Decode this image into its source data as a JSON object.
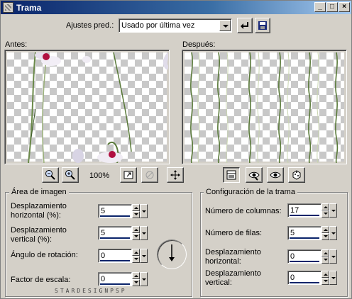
{
  "window": {
    "title": "Trama",
    "minimize_glyph": "_",
    "maximize_glyph": "□",
    "close_glyph": "×"
  },
  "presets": {
    "label": "Ajustes pred.:",
    "selected": "Usado por última vez"
  },
  "preview": {
    "before_label": "Antes:",
    "after_label": "Después:",
    "zoom": "100%"
  },
  "icons": {
    "zoom_out": "zoom-out-icon",
    "zoom_in": "zoom-in-icon",
    "navigate": "navigate-icon",
    "proof": "proof-icon",
    "pan": "pan-icon",
    "layout": "preview-layout-icon",
    "auto_proof": "auto-proof-icon",
    "eye": "eye-icon",
    "randomize": "randomize-dice-icon"
  },
  "image_area": {
    "title": "Área de imagen",
    "h_offset_label": "Desplazamiento\nhorizontal (%):",
    "h_offset_value": "5",
    "v_offset_label": "Desplazamiento\nvertical (%):",
    "v_offset_value": "5",
    "rotation_label": "Ángulo de rotación:",
    "rotation_value": "0",
    "scale_label": "Factor de escala:",
    "scale_value": "0"
  },
  "tile_config": {
    "title": "Configuración de la trama",
    "columns_label": "Número de columnas:",
    "columns_value": "17",
    "rows_label": "Número de filas:",
    "rows_value": "5",
    "h_offset_label": "Desplazamiento\nhorizontal:",
    "h_offset_value": "0",
    "v_offset_label": "Desplazamiento\nvertical:",
    "v_offset_value": "0"
  },
  "watermark": "STARDESIGNPSP",
  "colors": {
    "title_start": "#0a246a",
    "title_end": "#a6caf0",
    "face": "#d4d0c8",
    "flower": "#b01040",
    "stem": "#5a7a3a"
  }
}
